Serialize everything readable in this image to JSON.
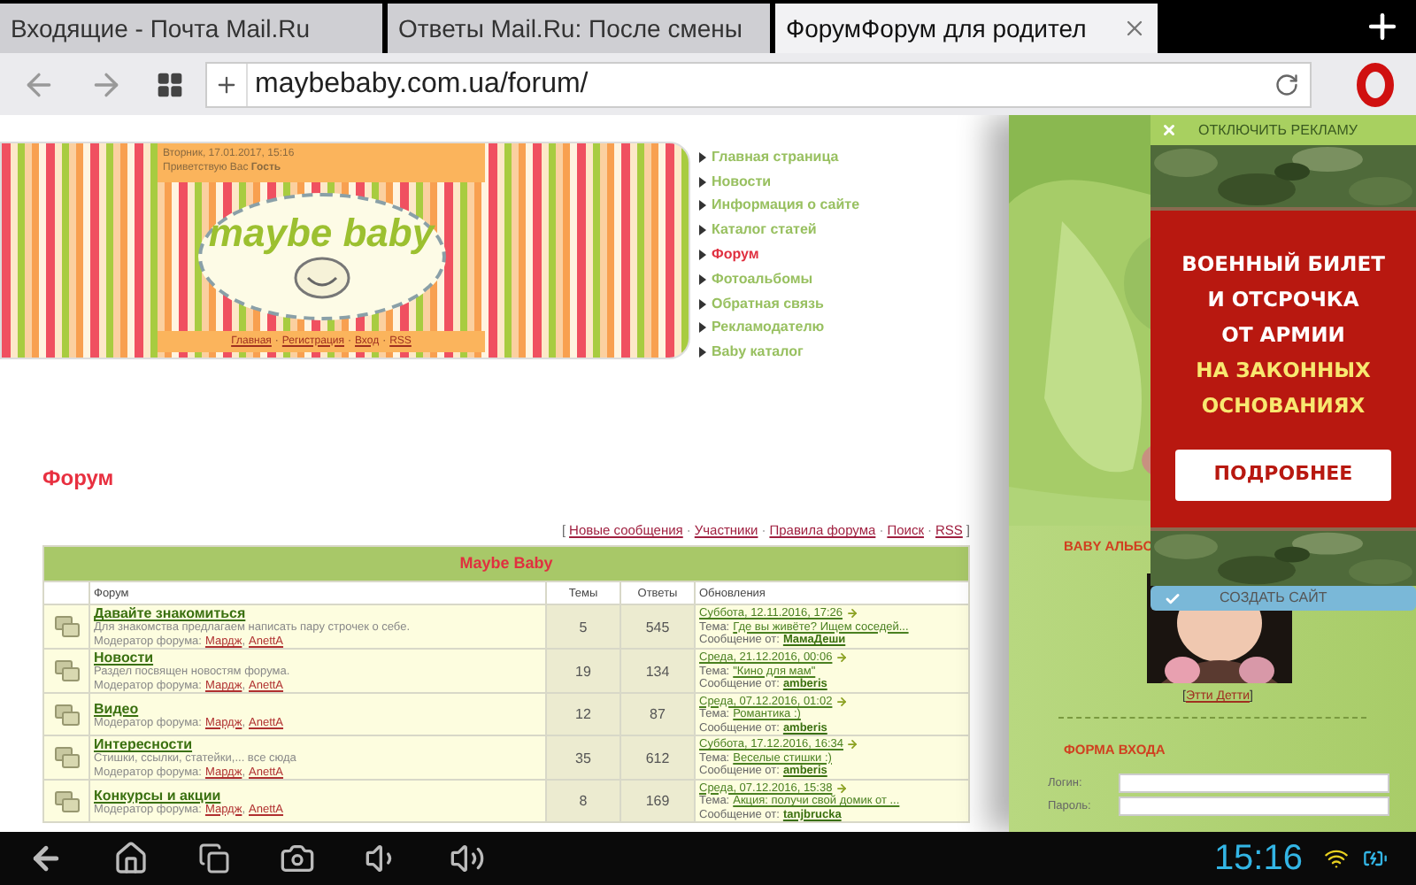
{
  "browser": {
    "tabs": [
      {
        "title": "Входящие - Почта Mail.Ru",
        "selected": false
      },
      {
        "title": "Ответы Mail.Ru: После смены",
        "selected": false
      },
      {
        "title": "ФорумФорум для родител",
        "selected": true
      }
    ],
    "url": "maybebaby.com.ua/forum/"
  },
  "page": {
    "header": {
      "date": "Вторник, 17.01.2017, 15:16",
      "greeting": "Приветствую Вас **Гость**",
      "logo": "maybe baby",
      "separator": "·",
      "links": [
        "Главная",
        "Регистрация",
        "Вход",
        "RSS"
      ]
    },
    "nav": [
      {
        "label": "Главная страница",
        "selected": false
      },
      {
        "label": "Новости",
        "selected": false
      },
      {
        "label": "Информация о сайте",
        "selected": false
      },
      {
        "label": "Каталог статей",
        "selected": false
      },
      {
        "label": "Форум",
        "selected": true
      },
      {
        "label": "Фотоальбомы",
        "selected": false
      },
      {
        "label": "Обратная связь",
        "selected": false
      },
      {
        "label": "Рекламодателю",
        "selected": false
      },
      {
        "label": "Baby каталог",
        "selected": false
      }
    ],
    "heading": "Форум",
    "forum_links": {
      "open": "[",
      "close": "]",
      "separator": "·",
      "links": [
        "Новые сообщения",
        "Участники",
        "Правила форума",
        "Поиск",
        "RSS"
      ]
    },
    "table": {
      "title": "Maybe Baby",
      "columns": [
        "Форум",
        "Темы",
        "Ответы",
        "Обновления"
      ],
      "rows": [
        {
          "title": "Давайте знакомиться",
          "description": "Для знакомства предлагаем написать пару строчек о себе.",
          "moderator_label": "Модератор форума:",
          "topic_label": "Тема:",
          "author_label": "Сообщение от:",
          "separator": ",",
          "moderators": [
            "Мардж",
            "AnettA"
          ],
          "topics": "5",
          "replies": "545",
          "date": "Суббота, 12.11.2016, 17:26",
          "topic": "Где вы живёте? Ищем соседей...",
          "author": "МамаДеши"
        },
        {
          "title": "Новости",
          "description": "Раздел посвящен новостям форума.",
          "moderator_label": "Модератор форума:",
          "topic_label": "Тема:",
          "author_label": "Сообщение от:",
          "separator": ",",
          "moderators": [
            "Мардж",
            "AnettA"
          ],
          "topics": "19",
          "replies": "134",
          "date": "Среда, 21.12.2016, 00:06",
          "topic": "\"Кино для мам\"",
          "author": "amberis"
        },
        {
          "title": "Видео",
          "moderator_label": "Модератор форума:",
          "topic_label": "Тема:",
          "author_label": "Сообщение от:",
          "separator": ",",
          "moderators": [
            "Мардж",
            "AnettA"
          ],
          "topics": "12",
          "replies": "87",
          "date": "Среда, 07.12.2016, 01:02",
          "topic": "Романтика :)",
          "author": "amberis"
        },
        {
          "title": "Интересности",
          "description": "Стишки, ссылки, статейки,... все сюда",
          "moderator_label": "Модератор форума:",
          "topic_label": "Тема:",
          "author_label": "Сообщение от:",
          "separator": ",",
          "moderators": [
            "Мардж",
            "AnettA"
          ],
          "topics": "35",
          "replies": "612",
          "date": "Суббота, 17.12.2016, 16:34",
          "topic": "Веселые стишки :)",
          "author": "amberis"
        },
        {
          "title": "Конкурсы и акции",
          "moderator_label": "Модератор форума:",
          "topic_label": "Тема:",
          "author_label": "Сообщение от:",
          "separator": ",",
          "moderators": [
            "Мардж",
            "AnettA"
          ],
          "topics": "8",
          "replies": "169",
          "date": "Среда, 07.12.2016, 15:38",
          "topic": "Акция: получи свой домик от ...",
          "author": "tanjbrucka"
        }
      ]
    }
  },
  "sidebar": {
    "album_title": "BABY АЛЬБО",
    "caption_open": "[",
    "caption": "Этти Детти",
    "caption_close": "]",
    "login_title": "ФОРМА ВХОДА",
    "login_label": "Логин:",
    "password_label": "Пароль:"
  },
  "ad": {
    "dismiss": "ОТКЛЮЧИТЬ РЕКЛАМУ",
    "lines": [
      "ВОЕННЫЙ БИЛЕТ",
      "И ОТСРОЧКА",
      "ОТ АРМИИ"
    ],
    "highlight": [
      "НА ЗАКОННЫХ",
      "ОСНОВАНИЯХ"
    ],
    "button": "ПОДРОБНЕЕ",
    "create": "СОЗДАТЬ САЙТ"
  },
  "status_bar": {
    "time": "15:16"
  }
}
